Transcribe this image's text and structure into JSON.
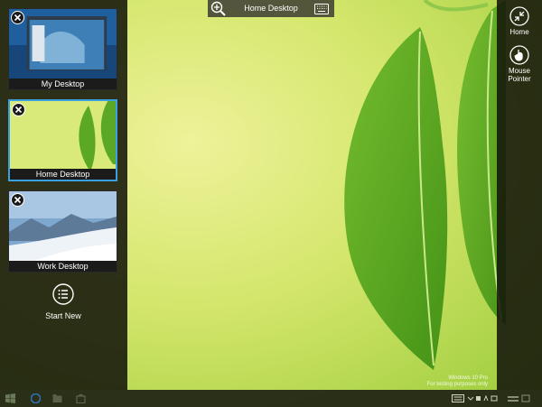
{
  "toolbar": {
    "title": "Home Desktop",
    "zoom_icon": "zoom-in-icon",
    "keyboard_icon": "keyboard-icon"
  },
  "sessions": [
    {
      "label": "My Desktop",
      "selected": false
    },
    {
      "label": "Home Desktop",
      "selected": true
    },
    {
      "label": "Work Desktop",
      "selected": false
    }
  ],
  "start_new": {
    "label": "Start New",
    "icon": "list-icon"
  },
  "right_panel": {
    "home": {
      "label": "Home",
      "icon": "home-collapse-icon"
    },
    "mouse_pointer": {
      "label_line1": "Mouse",
      "label_line2": "Pointer",
      "icon": "hand-pointer-icon"
    }
  },
  "watermark": {
    "line1": "Windows 10 Pro",
    "line2": "For testing purposes only"
  },
  "colors": {
    "selection_border": "#3aa0e0",
    "panel_bg": "#14160a",
    "wallpaper_light": "#e6ef8a",
    "wallpaper_green": "#7fc12a"
  }
}
